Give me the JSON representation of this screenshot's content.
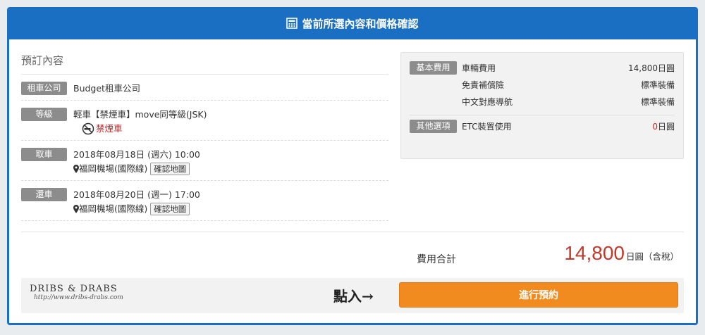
{
  "header": {
    "title": "當前所選內容和價格確認"
  },
  "booking": {
    "section_title": "預訂內容",
    "company": {
      "tag": "租車公司",
      "value": "Budget租車公司"
    },
    "grade": {
      "tag": "等級",
      "value": "輕車【禁煙車】move同等級(JSK)",
      "smoke_label": "禁煙車"
    },
    "pickup": {
      "tag": "取車",
      "datetime": "2018年08月18日 (週六) 10:00",
      "location": "福岡機場(國際線)",
      "map_button": "確認地圖"
    },
    "return": {
      "tag": "還車",
      "datetime": "2018年08月20日 (週一) 17:00",
      "location": "福岡機場(國際線)",
      "map_button": "確認地圖"
    }
  },
  "fees": {
    "basic": {
      "tag": "基本費用",
      "lines": [
        {
          "label": "車輛費用",
          "value": "14,800日圓"
        },
        {
          "label": "免責補償險",
          "value": "標準裝備"
        },
        {
          "label": "中文對應導航",
          "value": "標準裝備"
        }
      ]
    },
    "other": {
      "tag": "其他選項",
      "lines": [
        {
          "label": "ETC裝置使用",
          "value_num": "0",
          "value_unit": "日圓"
        }
      ]
    }
  },
  "total": {
    "label": "費用合計",
    "amount": "14,800",
    "unit": "日圓（含稅）"
  },
  "footer": {
    "brand_name": "DRIBS & DRABS",
    "brand_url": "http://www.dribs-drabs.com",
    "hint": "點入→",
    "reserve_button": "進行預約"
  },
  "colors": {
    "header": "#1a6fc2",
    "accent_button": "#f18a1f",
    "price": "#c0392b",
    "tag": "#8c8c8c"
  }
}
